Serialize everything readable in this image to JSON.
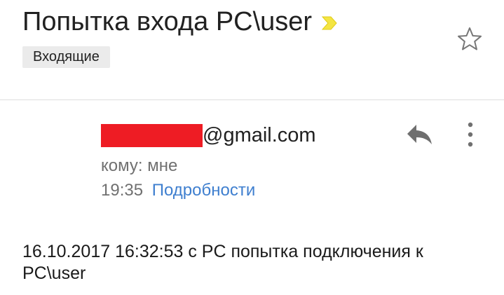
{
  "message": {
    "subject": "Попытка входа PC\\user",
    "label": "Входящие",
    "sender_domain": "@gmail.com",
    "recipient": "кому: мне",
    "time": "19:35",
    "details_link": "Подробности",
    "body": "16.10.2017 16:32:53 с PC попытка подключения к PC\\user"
  },
  "icons": {
    "importance": "importance-marker-icon",
    "star": "star-icon",
    "reply": "reply-icon",
    "more": "more-vertical-icon"
  },
  "colors": {
    "importance": "#f4e542",
    "redaction": "#ee1c24",
    "link": "#3f7fcf",
    "secondary_text": "#707070",
    "label_background": "#ebebeb"
  }
}
